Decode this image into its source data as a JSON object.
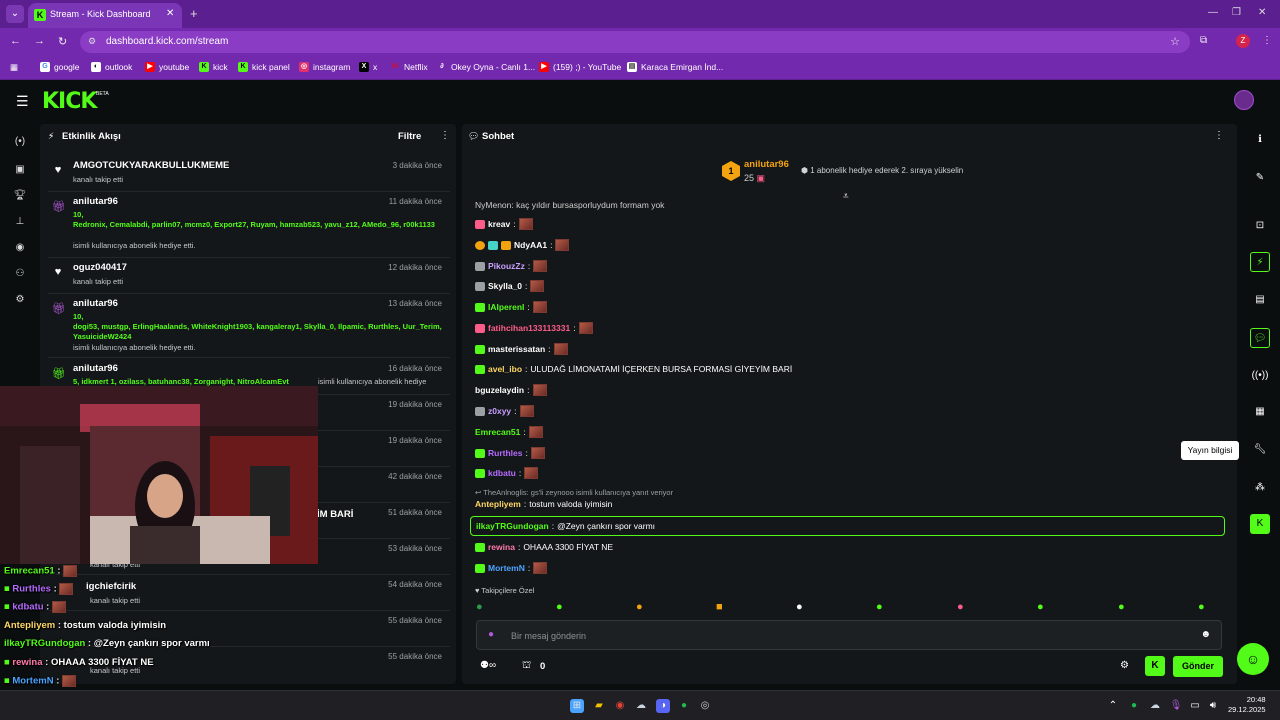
{
  "browser": {
    "tab_title": "Stream - Kick Dashboard",
    "url": "dashboard.kick.com/stream",
    "profile_initial": "Z",
    "bookmarks": [
      {
        "label": "google"
      },
      {
        "label": "outlook"
      },
      {
        "label": "youtube"
      },
      {
        "label": "kick"
      },
      {
        "label": "kick panel"
      },
      {
        "label": "instagram"
      },
      {
        "label": "x"
      },
      {
        "label": "Netflix"
      },
      {
        "label": "Okey Oyna - Canlı 1..."
      },
      {
        "label": "(159) ;) - YouTube"
      },
      {
        "label": "Karaca Emirgan İnd..."
      }
    ]
  },
  "header": {
    "logo": "KICK",
    "beta": "BETA"
  },
  "activity": {
    "title": "Etkinlik Akışı",
    "filter_label": "Filtre",
    "items": [
      {
        "name": "AMGOTCUKYARAKBULLUKMEME",
        "time": "3 dakika önce",
        "sub": "kanalı takip etti"
      },
      {
        "name": "anilutar96",
        "time": "11 dakika önce",
        "count": "10,",
        "users": "Redronix, Cemalabdi, parlin07, mcmz0, Export27, Ruyam, hamzab523, yavu_z12, AMedo_96, r00k1133",
        "sub": "isimli kullanıcıya abonelik hediye etti."
      },
      {
        "name": "oguz040417",
        "time": "12 dakika önce",
        "sub": "kanalı takip etti"
      },
      {
        "name": "anilutar96",
        "time": "13 dakika önce",
        "count": "10,",
        "users": "dogi53, mustgp, ErlingHaalands, WhiteKnight1903, kangaleray1, Skylla_0, Ilpamic, Rurthles, Uur_Terim, YasuicideW2424",
        "sub": "isimli kullanıcıya abonelik hediye etti."
      },
      {
        "name": "anilutar96",
        "time": "16 dakika önce",
        "users": "5, idkmert 1, ozilass, batuhanc38, Zorganight, NitroAlcamEvt",
        "sub": "isimli kullanıcıya abonelik hediye"
      },
      {
        "time": "19 dakika önce"
      },
      {
        "time": "19 dakika önce"
      },
      {
        "time": "42 dakika önce"
      },
      {
        "time": "51 dakika önce"
      },
      {
        "time": "53 dakika önce",
        "sub": "kanalı takip etti"
      },
      {
        "name": "igchiefcirik",
        "time": "54 dakika önce",
        "sub": "kanalı takip etti"
      },
      {
        "time": "55 dakika önce"
      },
      {
        "time": "55 dakika önce",
        "sub": "kanalı takip etti"
      }
    ],
    "overlay_fragment": "İM BARİ"
  },
  "overlay_chat": [
    {
      "user": "Emrecan51",
      "color": "#53fc18"
    },
    {
      "user": "Rurthles",
      "color": "#b56bff"
    },
    {
      "user": "kdbatu",
      "color": "#b56bff"
    },
    {
      "user": "Antepliyem",
      "color": "#ffd766",
      "text": "tostum valoda iyimisin"
    },
    {
      "user": "ilkayTRGundogan",
      "color": "#53fc18",
      "text": "@Zeyn çankırı spor varmı"
    },
    {
      "user": "rewina",
      "color": "#ff7aa8",
      "text": "OHAAA 3300 FİYAT NE"
    },
    {
      "user": "MortemN",
      "color": "#4ea3ff"
    }
  ],
  "chat": {
    "title": "Sohbet",
    "pinned": {
      "rank": "1",
      "user": "anilutar96",
      "count": "25",
      "info": "1 abonelik hediye ederek 2. sıraya yükselin"
    },
    "top_fragment": "NyMenon: kaç yıldır bursasporluydum formam yok",
    "messages": [
      {
        "user": "kreav",
        "color": "#ffffff"
      },
      {
        "user": "NdyAA1",
        "color": "#ffffff"
      },
      {
        "user": "PikouzZz",
        "color": "#c9a0ff"
      },
      {
        "user": "Skylla_0",
        "color": "#ffffff"
      },
      {
        "user": "IAlperenI",
        "color": "#53fc18"
      },
      {
        "user": "fatihcihan133113331",
        "color": "#ff5c8a"
      },
      {
        "user": "masterissatan",
        "color": "#ffffff"
      },
      {
        "user": "avel_ibo",
        "color": "#ffd766",
        "text": "ULUDAĞ LİMONATAMİ İÇERKEN BURSA FORMASİ GİYEYİM BARİ"
      },
      {
        "user": "bguzelaydin",
        "color": "#ffffff"
      },
      {
        "user": "z0xyy",
        "color": "#c9a0ff"
      },
      {
        "user": "Emrecan51",
        "color": "#53fc18"
      },
      {
        "user": "Rurthles",
        "color": "#b56bff"
      },
      {
        "user": "kdbatu",
        "color": "#b56bff"
      }
    ],
    "reply_context": "TheAnlnoglis: gs'li zeynooo isimli kullanıcıya yanıt veriyor",
    "reply_message": {
      "user": "Antepliyem",
      "text": "tostum valoda iyimisin"
    },
    "highlighted": {
      "user": "ilkayTRGundogan",
      "text": "@Zeyn çankırı spor varmı"
    },
    "after": [
      {
        "user": "rewina",
        "color": "#ff7aa8",
        "text": "OHAAA 3300 FİYAT NE"
      },
      {
        "user": "MortemN",
        "color": "#4ea3ff"
      }
    ],
    "followers_label": "Takipçilere Özel",
    "input_placeholder": "Bir mesaj gönderin",
    "points": "0",
    "send_label": "Gönder"
  },
  "right_rail": {
    "tooltip": "Yayın bilgisi"
  },
  "taskbar": {
    "time": "20:48",
    "date": "29.12.2025"
  },
  "colors": {
    "brand": "#53fc18",
    "browser": "#7329ad"
  }
}
